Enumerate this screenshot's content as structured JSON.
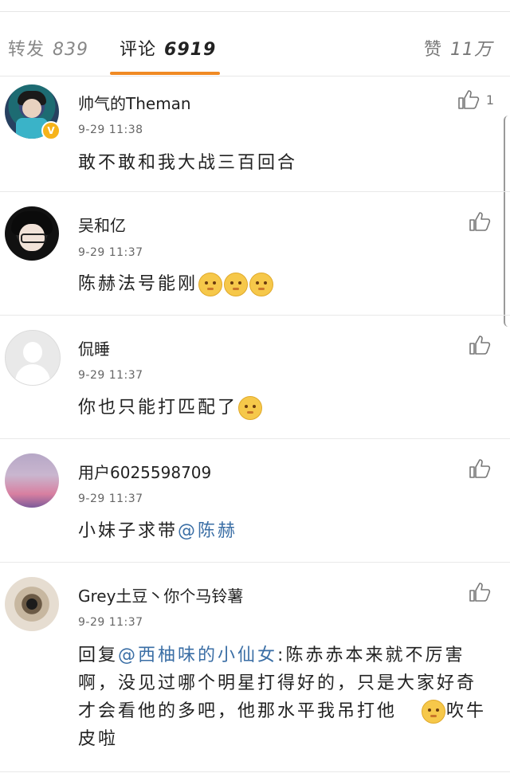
{
  "tabs": {
    "repost_label": "转发",
    "repost_count": "839",
    "comments_label": "评论",
    "comments_count": "6919",
    "likes_label": "赞",
    "likes_count": "11万"
  },
  "colors": {
    "accent": "#f08a24",
    "mention": "#3a6ea5",
    "badge": "#f6b31a"
  },
  "comments": [
    {
      "name": "帅气的Theman",
      "time": "9-29 11:38",
      "text": "敢不敢和我大战三百回合",
      "like_count": "1",
      "verified_badge": "V"
    },
    {
      "name": "吴和亿",
      "time": "9-29 11:37",
      "text": "陈赫法号能刚"
    },
    {
      "name": "侃睡",
      "time": "9-29 11:37",
      "text": "你也只能打匹配了"
    },
    {
      "name": "用户6025598709",
      "time": "9-29 11:37",
      "text_before": "小妹子求带",
      "mention": "@陈赫"
    },
    {
      "name": "Grey土豆丶你个马铃薯",
      "time": "9-29 11:37",
      "text_before": "回复",
      "mention": "@西柚味的小仙女",
      "text_after": ":陈赤赤本来就不厉害啊，没见过哪个明星打得好的，只是大家好奇才会看他的多吧，他那水平我吊打他",
      "text_tail": "吹牛皮啦"
    }
  ]
}
